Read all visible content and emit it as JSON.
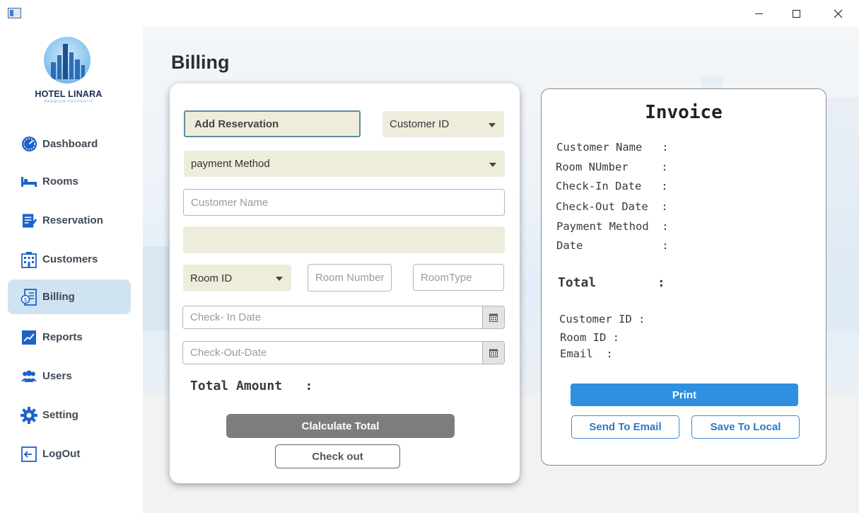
{
  "window": {
    "controls": {
      "minimize": "minimize-icon",
      "maximize": "maximize-icon",
      "close": "close-icon"
    }
  },
  "brand": {
    "name": "HOTEL LINARA",
    "tagline": "PREMIUM PROPERTY"
  },
  "sidebar": {
    "items": [
      {
        "label": "Dashboard",
        "icon": "speedometer-icon",
        "active": false
      },
      {
        "label": "Rooms",
        "icon": "bed-icon",
        "active": false
      },
      {
        "label": "Reservation",
        "icon": "clipboard-edit-icon",
        "active": false
      },
      {
        "label": "Customers",
        "icon": "building-icon",
        "active": false
      },
      {
        "label": "Billing",
        "icon": "bill-icon",
        "active": true
      },
      {
        "label": "Reports",
        "icon": "chart-icon",
        "active": false
      },
      {
        "label": "Users",
        "icon": "users-icon",
        "active": false
      },
      {
        "label": "Setting",
        "icon": "gear-icon",
        "active": false
      },
      {
        "label": "LogOut",
        "icon": "logout-icon",
        "active": false
      }
    ]
  },
  "page": {
    "title": "Billing"
  },
  "form": {
    "add_reservation": "Add Reservation",
    "customer_id_select": "Customer ID",
    "payment_method_select": "payment Method",
    "customer_name_placeholder": "Customer Name",
    "info_field": "",
    "room_id_select": "Room ID",
    "room_number_placeholder": "Room Number",
    "room_type_placeholder": "RoomType",
    "check_in_placeholder": "Check- In Date",
    "check_out_placeholder": "Check-Out-Date",
    "total_amount": "Total Amount   :",
    "calculate_button": "Clalculate Total",
    "checkout_button": "Check out"
  },
  "invoice": {
    "title": "Invoice",
    "lines": [
      "Customer Name   :",
      "Room NUmber     :",
      "Check-In Date   :",
      "Check-Out Date  :",
      "Payment Method  :",
      "Date            :"
    ],
    "total": "Total        :",
    "customer_id": "Customer ID :",
    "room_id": "Room ID :",
    "email": "Email  :",
    "print_button": "Print",
    "email_button": "Send To Email",
    "local_button": "Save To Local"
  },
  "colors": {
    "accent_blue": "#2f8fe0",
    "active_nav": "#cfe4f0",
    "beige_field": "#eeeddb",
    "calc_button": "#7d7d7d"
  }
}
